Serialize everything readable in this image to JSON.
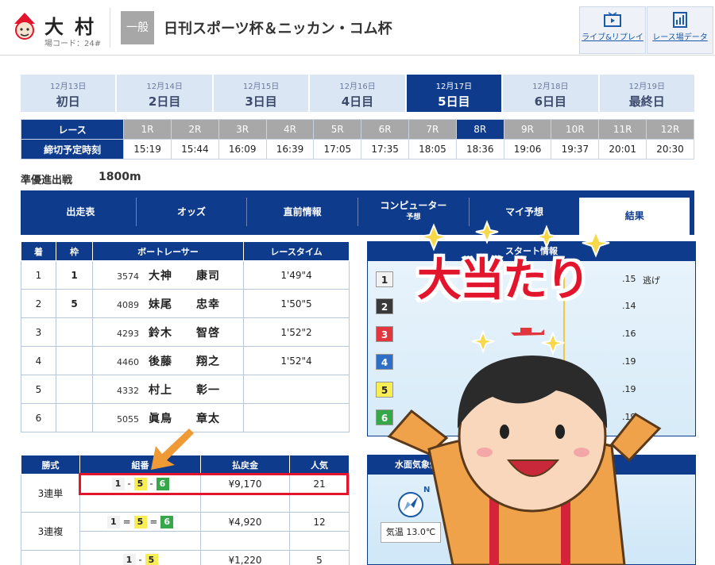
{
  "header": {
    "venue_name": "大村",
    "venue_code": "場コード：24#",
    "grade": "一般",
    "race_title": "日刊スポーツ杯＆ニッカン・コム杯",
    "live_btn": "ライブ&リプレイ",
    "data_btn": "レース場データ"
  },
  "days": [
    {
      "date": "12月13日",
      "name": "初日"
    },
    {
      "date": "12月14日",
      "name": "2日目"
    },
    {
      "date": "12月15日",
      "name": "3日目"
    },
    {
      "date": "12月16日",
      "name": "4日目"
    },
    {
      "date": "12月17日",
      "name": "5日目"
    },
    {
      "date": "12月18日",
      "name": "6日目"
    },
    {
      "date": "12月19日",
      "name": "最終日"
    }
  ],
  "races": {
    "race_label": "レース",
    "time_label": "締切予定時刻",
    "numbers": [
      "1R",
      "2R",
      "3R",
      "4R",
      "5R",
      "6R",
      "7R",
      "8R",
      "9R",
      "10R",
      "11R",
      "12R"
    ],
    "times": [
      "15:19",
      "15:44",
      "16:09",
      "16:39",
      "17:05",
      "17:35",
      "18:05",
      "18:36",
      "19:06",
      "19:37",
      "20:01",
      "20:30"
    ]
  },
  "race_info": {
    "kind": "準優進出戦",
    "distance": "1800m"
  },
  "menu": [
    "出走表",
    "オッズ",
    "直前情報",
    "コンピューター",
    "マイ予想",
    "結果"
  ],
  "menu_sub": "予想",
  "results": {
    "headers": [
      "着",
      "枠",
      "ボートレーサー",
      "レースタイム"
    ],
    "rows": [
      {
        "pos": "1",
        "frame": "1",
        "reg": "3574",
        "name": "大神　　康司",
        "time": "1'49\"4"
      },
      {
        "pos": "2",
        "frame": "5",
        "reg": "4089",
        "name": "妹尾　　忠幸",
        "time": "1'50\"5"
      },
      {
        "pos": "3",
        "frame": "6",
        "reg": "4293",
        "name": "鈴木　　智啓",
        "time": "1'52\"2"
      },
      {
        "pos": "4",
        "frame": "2",
        "reg": "4460",
        "name": "後藤　　翔之",
        "time": "1'52\"4"
      },
      {
        "pos": "5",
        "frame": "3",
        "reg": "4332",
        "name": "村上　　彰一",
        "time": ""
      },
      {
        "pos": "6",
        "frame": "4",
        "reg": "5055",
        "name": "眞鳥　　章太",
        "time": ""
      }
    ]
  },
  "start_info": {
    "title": "スタート情報",
    "frames": [
      "1",
      "2",
      "3",
      "4",
      "5",
      "6"
    ],
    "timings": [
      ".15",
      ".14",
      ".16",
      ".19",
      ".19",
      ".19"
    ],
    "winning_move": "逃げ"
  },
  "payout": {
    "headers": [
      "勝式",
      "組番",
      "払戻金",
      "人気"
    ],
    "rows": [
      {
        "type": "3連単",
        "c1": "1",
        "s1": "-",
        "c2": "5",
        "s2": "-",
        "c3": "6",
        "amount": "¥9,170",
        "pop": "21"
      },
      {
        "type": "3連複",
        "c1": "1",
        "s1": "=",
        "c2": "5",
        "s2": "=",
        "c3": "6",
        "amount": "¥4,920",
        "pop": "12"
      },
      {
        "type": "",
        "c1": "1",
        "s1": "-",
        "c2": "5",
        "s2": "",
        "c3": "",
        "amount": "¥1,220",
        "pop": "5"
      }
    ]
  },
  "weather": {
    "title": "水面気象情報",
    "compass": "N",
    "temp": "気温 13.0℃"
  },
  "overlay": {
    "text": "大当たり"
  }
}
